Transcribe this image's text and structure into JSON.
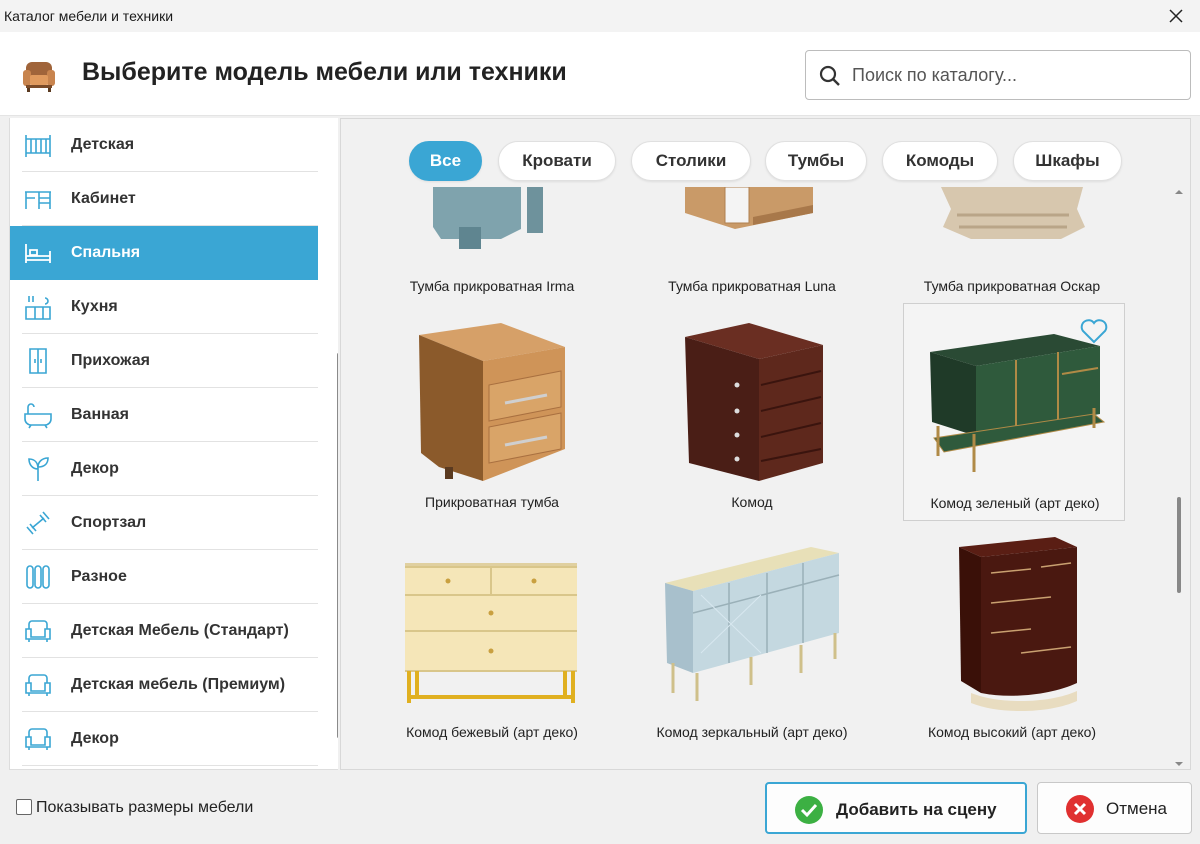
{
  "window": {
    "title": "Каталог мебели и техники"
  },
  "header": {
    "title": "Выберите модель мебели или техники"
  },
  "search": {
    "placeholder": "Поиск по каталогу..."
  },
  "sidebar": {
    "items": [
      {
        "label": "Детская",
        "icon": "crib-icon",
        "active": false
      },
      {
        "label": "Кабинет",
        "icon": "desk-icon",
        "active": false
      },
      {
        "label": "Спальня",
        "icon": "bed-icon",
        "active": true
      },
      {
        "label": "Кухня",
        "icon": "kitchen-icon",
        "active": false
      },
      {
        "label": "Прихожая",
        "icon": "wardrobe-icon",
        "active": false
      },
      {
        "label": "Ванная",
        "icon": "bathtub-icon",
        "active": false
      },
      {
        "label": "Декор",
        "icon": "plant-icon",
        "active": false
      },
      {
        "label": "Спортзал",
        "icon": "dumbbell-icon",
        "active": false
      },
      {
        "label": "Разное",
        "icon": "radiator-icon",
        "active": false
      },
      {
        "label": "Детская Мебель (Стандарт)",
        "icon": "armchair-icon",
        "active": false
      },
      {
        "label": "Детская мебель (Премиум)",
        "icon": "armchair-icon",
        "active": false
      },
      {
        "label": "Декор",
        "icon": "armchair-icon",
        "active": false
      }
    ]
  },
  "filters": [
    {
      "label": "Все",
      "active": true
    },
    {
      "label": "Кровати",
      "active": false
    },
    {
      "label": "Столики",
      "active": false
    },
    {
      "label": "Тумбы",
      "active": false
    },
    {
      "label": "Комоды",
      "active": false
    },
    {
      "label": "Шкафы",
      "active": false
    }
  ],
  "catalog": {
    "items": [
      {
        "name": "Тумба прикроватная Irma"
      },
      {
        "name": "Тумба прикроватная Luna"
      },
      {
        "name": "Тумба прикроватная Оскар"
      },
      {
        "name": "Прикроватная тумба"
      },
      {
        "name": "Комод"
      },
      {
        "name": "Комод зеленый (арт деко)",
        "selected": true,
        "favorite_icon": "heart-icon"
      },
      {
        "name": "Комод бежевый (арт деко)"
      },
      {
        "name": "Комод зеркальный (арт деко)"
      },
      {
        "name": "Комод высокий (арт деко)"
      }
    ]
  },
  "footer": {
    "show_dimensions_label": "Показывать размеры мебели",
    "show_dimensions_checked": false,
    "add_label": "Добавить на сцену",
    "cancel_label": "Отмена"
  },
  "colors": {
    "accent": "#3aa6d4",
    "add_icon": "#3cb043",
    "cancel_icon": "#e03030"
  }
}
